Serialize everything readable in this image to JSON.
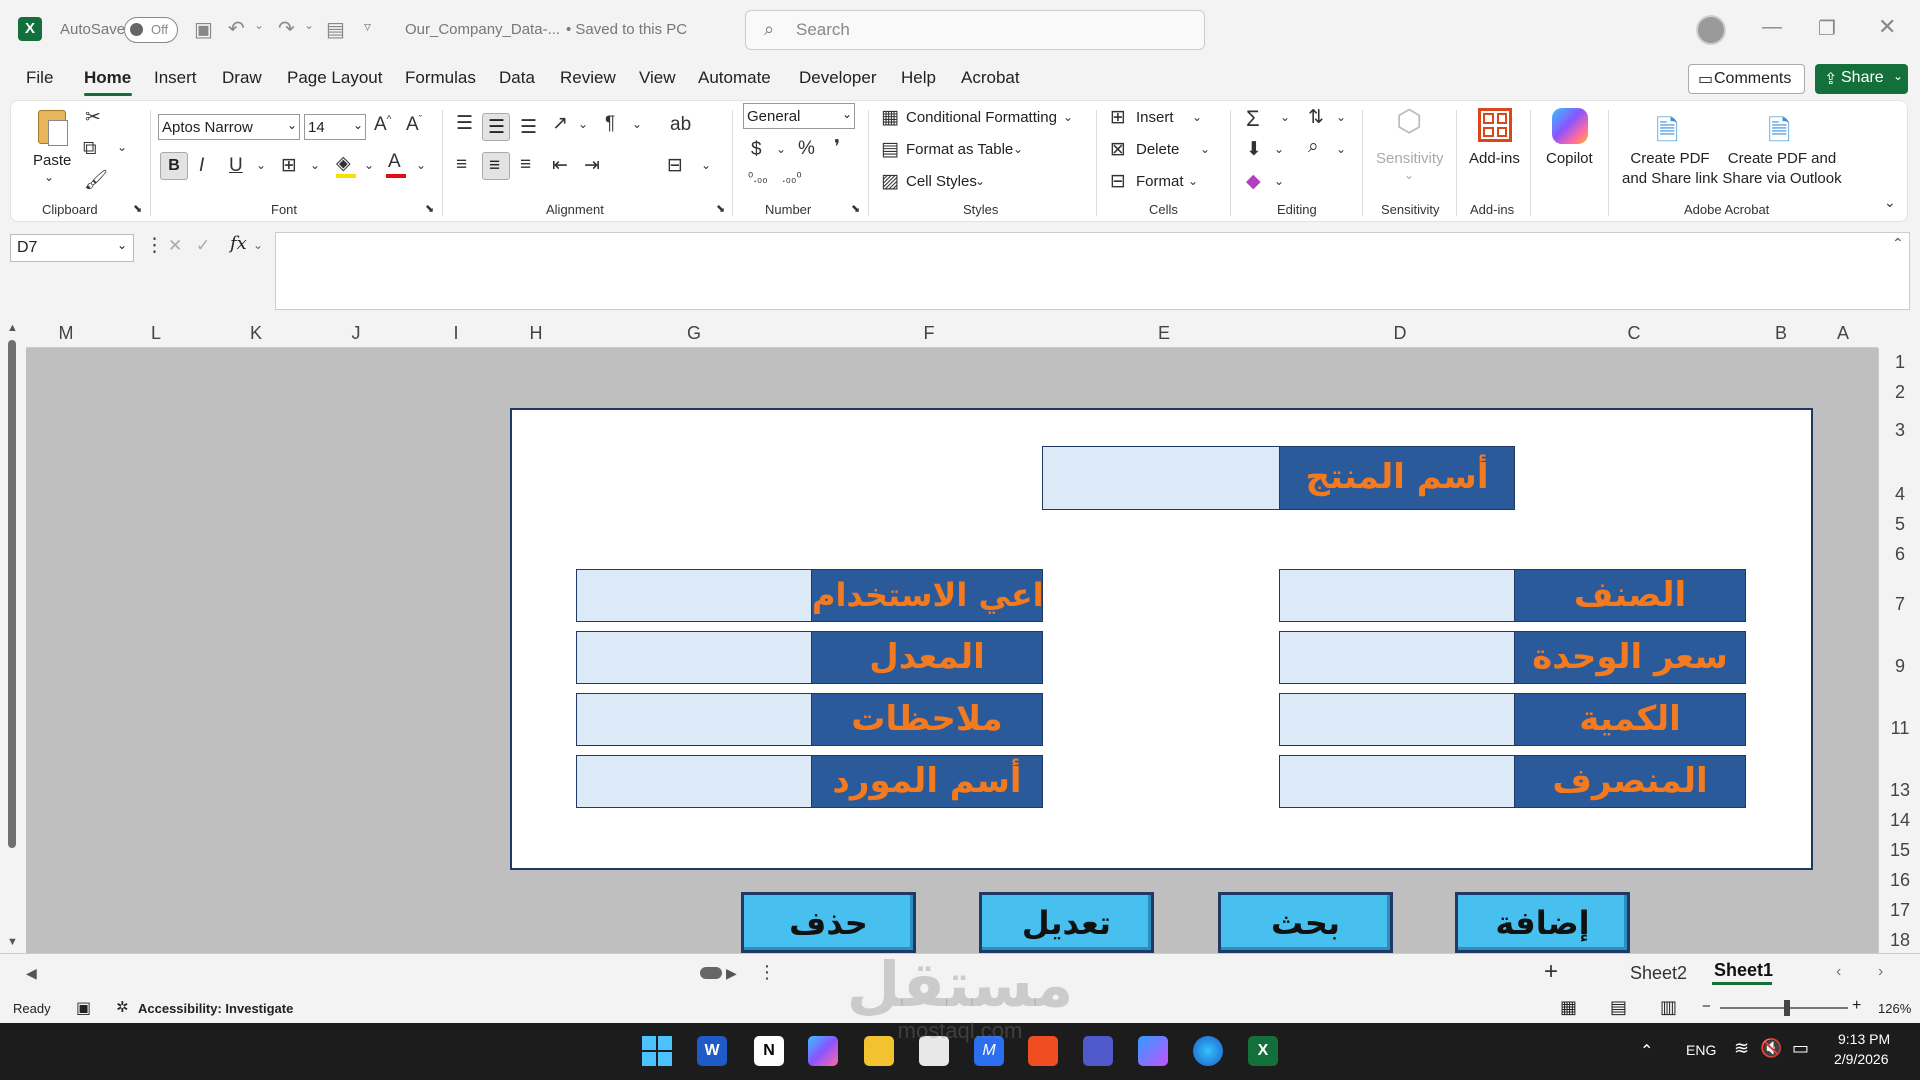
{
  "titlebar": {
    "autosave_label": "AutoSave",
    "autosave_state": "Off",
    "file_name": "Our_Company_Data-...",
    "save_status": "• Saved to this PC",
    "search_placeholder": "Search"
  },
  "menu": {
    "items": [
      "File",
      "Home",
      "Insert",
      "Draw",
      "Page Layout",
      "Formulas",
      "Data",
      "Review",
      "View",
      "Automate",
      "Developer",
      "Help",
      "Acrobat"
    ],
    "active": "Home",
    "comments_label": "Comments",
    "share_label": "Share"
  },
  "ribbon": {
    "clipboard": {
      "paste_label": "Paste",
      "group_label": "Clipboard"
    },
    "font": {
      "font_name": "Aptos Narrow",
      "font_size": "14",
      "group_label": "Font"
    },
    "alignment": {
      "group_label": "Alignment"
    },
    "number": {
      "format": "General",
      "group_label": "Number"
    },
    "styles": {
      "conditional_formatting": "Conditional Formatting",
      "format_as_table": "Format as Table",
      "cell_styles": "Cell Styles",
      "group_label": "Styles"
    },
    "cells": {
      "insert": "Insert",
      "delete": "Delete",
      "format": "Format",
      "group_label": "Cells"
    },
    "editing": {
      "group_label": "Editing"
    },
    "sensitivity": {
      "label": "Sensitivity",
      "group_label": "Sensitivity"
    },
    "addins": {
      "label": "Add-ins",
      "group_label": "Add-ins"
    },
    "copilot": {
      "label": "Copilot"
    },
    "acrobat": {
      "create_pdf_share_link_1": "Create PDF",
      "create_pdf_share_link_2": "and Share link",
      "create_pdf_outlook_1": "Create PDF and",
      "create_pdf_outlook_2": "Share via Outlook",
      "group_label": "Adobe Acrobat"
    }
  },
  "formula_bar": {
    "cell_ref": "D7",
    "fx": "fx",
    "value": ""
  },
  "grid": {
    "columns": [
      "M",
      "L",
      "K",
      "J",
      "I",
      "H",
      "G",
      "F",
      "E",
      "D",
      "C",
      "B",
      "A"
    ],
    "rows": [
      "1",
      "2",
      "3",
      "4",
      "5",
      "6",
      "7",
      "9",
      "11",
      "13",
      "14",
      "15",
      "16",
      "17",
      "18"
    ]
  },
  "form": {
    "product_name": "أسم المنتج",
    "right_labels": [
      "الصنف",
      "سعر الوحدة",
      "الكمية",
      "المنصرف"
    ],
    "left_labels": [
      "دواعي الاستخدام",
      "المعدل",
      "ملاحظات",
      "أسم المورد"
    ],
    "buttons": {
      "delete": "حذف",
      "edit": "تعديل",
      "search": "بحث",
      "add": "إضافة"
    }
  },
  "sheets": {
    "tabs": [
      "Sheet2",
      "Sheet1"
    ],
    "active": "Sheet1"
  },
  "status": {
    "ready": "Ready",
    "accessibility": "Accessibility: Investigate",
    "zoom": "126%"
  },
  "taskbar": {
    "language": "ENG",
    "time": "9:13 PM",
    "date": "2/9/2026"
  },
  "watermark": {
    "main": "مستقل",
    "sub": "mostaql.com"
  },
  "colors": {
    "excel_green": "#13703a",
    "label_fill": "#2a5a9a",
    "label_text": "#f47a20",
    "input_fill": "#dce9f7",
    "button_fill": "#47c0f0"
  }
}
